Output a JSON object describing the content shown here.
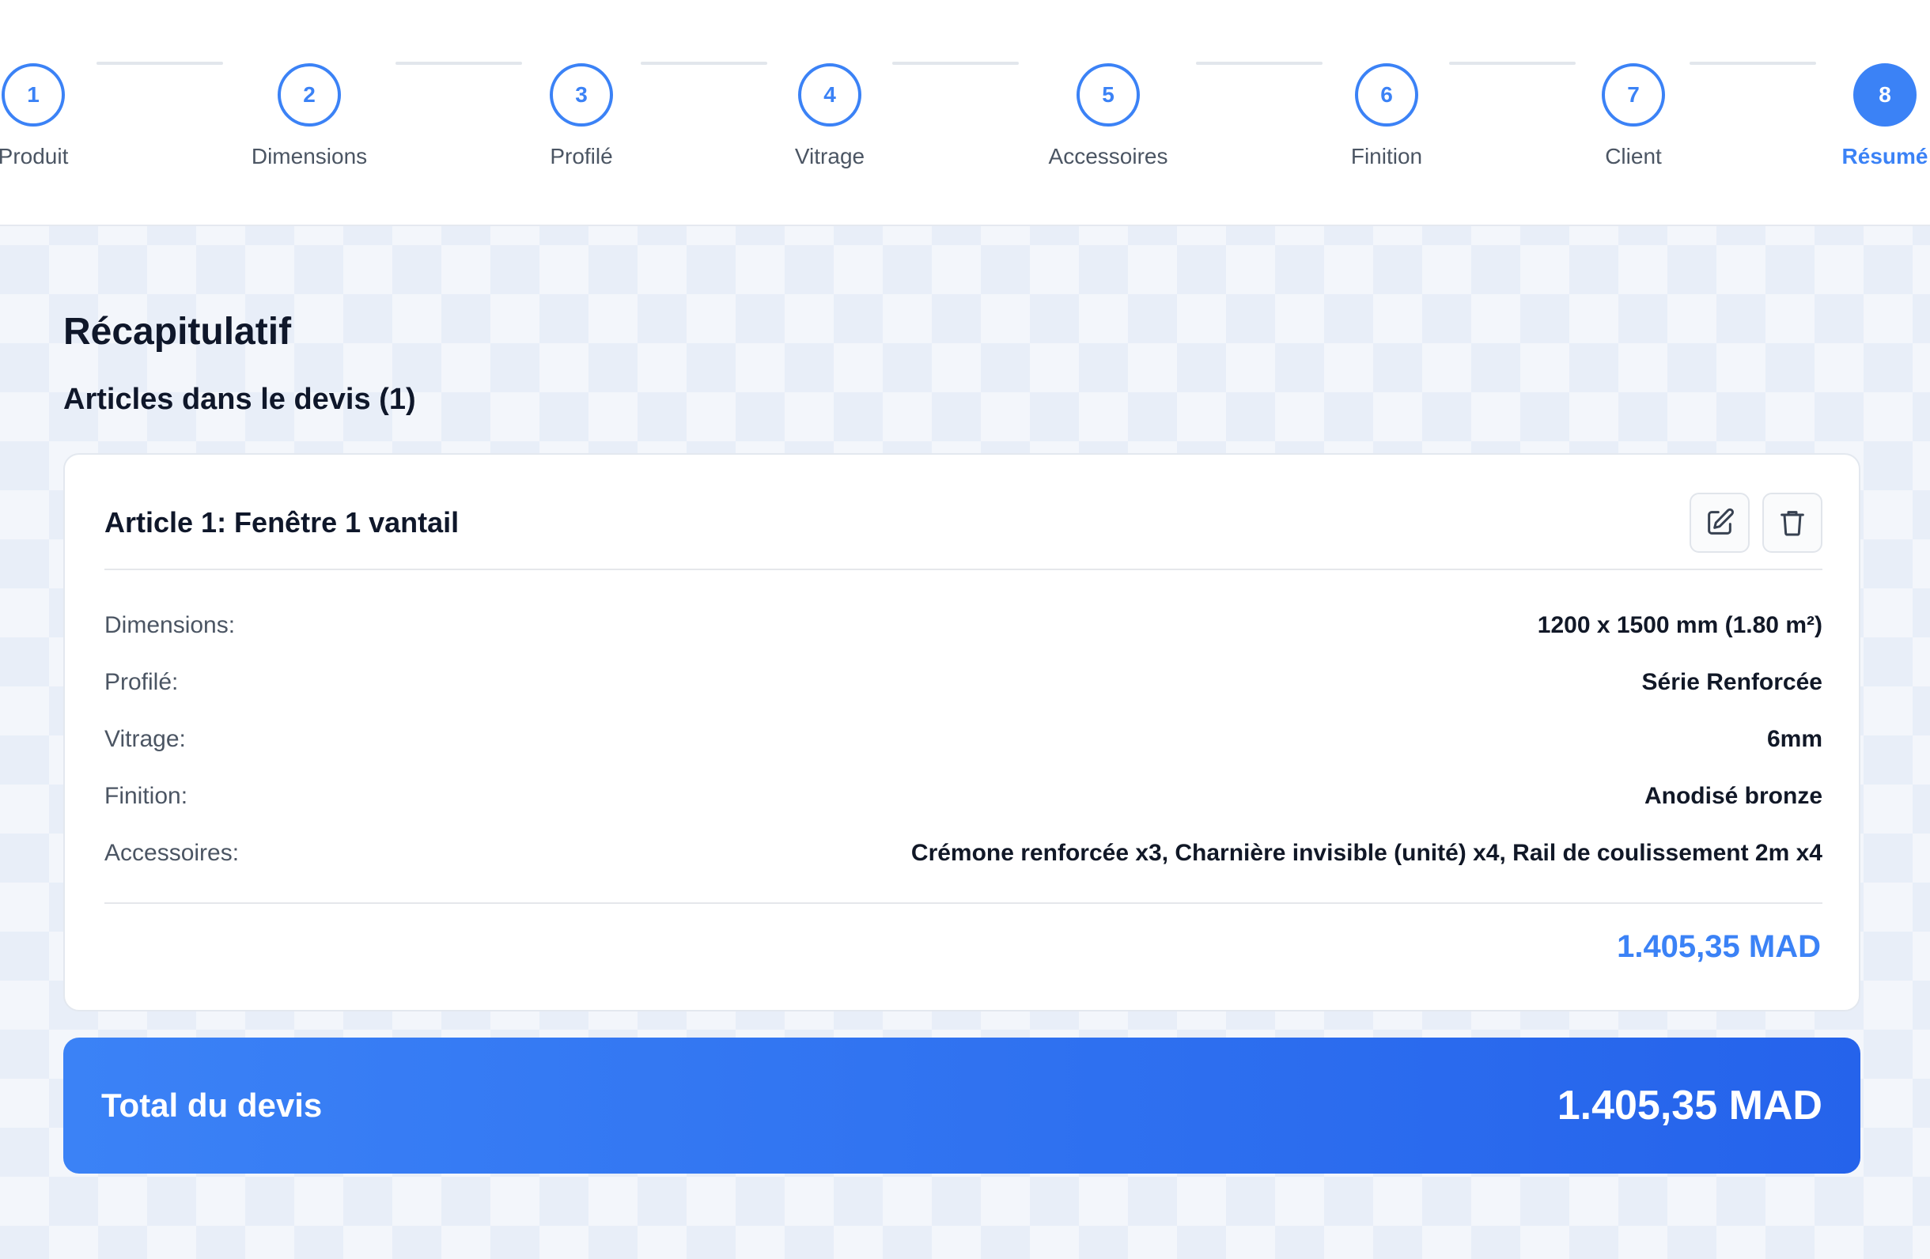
{
  "stepper": {
    "steps": [
      {
        "number": "1",
        "label": "Produit"
      },
      {
        "number": "2",
        "label": "Dimensions"
      },
      {
        "number": "3",
        "label": "Profilé"
      },
      {
        "number": "4",
        "label": "Vitrage"
      },
      {
        "number": "5",
        "label": "Accessoires"
      },
      {
        "number": "6",
        "label": "Finition"
      },
      {
        "number": "7",
        "label": "Client"
      },
      {
        "number": "8",
        "label": "Résumé"
      }
    ],
    "active_step": "8"
  },
  "summary": {
    "title": "Récapitulatif",
    "items_heading": "Articles dans le devis (1)"
  },
  "article": {
    "title": "Article 1: Fenêtre 1 vantail",
    "edit_icon": "edit-icon",
    "delete_icon": "trash-icon",
    "details": [
      {
        "label": "Dimensions:",
        "value": "1200 x 1500 mm (1.80 m²)"
      },
      {
        "label": "Profilé:",
        "value": "Série Renforcée"
      },
      {
        "label": "Vitrage:",
        "value": "6mm"
      },
      {
        "label": "Finition:",
        "value": "Anodisé bronze"
      },
      {
        "label": "Accessoires:",
        "value": "Crémone renforcée x3, Charnière invisible (unité) x4, Rail de coulissement 2m x4"
      }
    ],
    "price": "1.405,35 MAD"
  },
  "total": {
    "label": "Total du devis",
    "amount": "1.405,35 MAD"
  },
  "colors": {
    "accent": "#3b82f6",
    "accent_dark": "#2563eb",
    "text": "#0f172a",
    "muted": "#4b5563"
  }
}
